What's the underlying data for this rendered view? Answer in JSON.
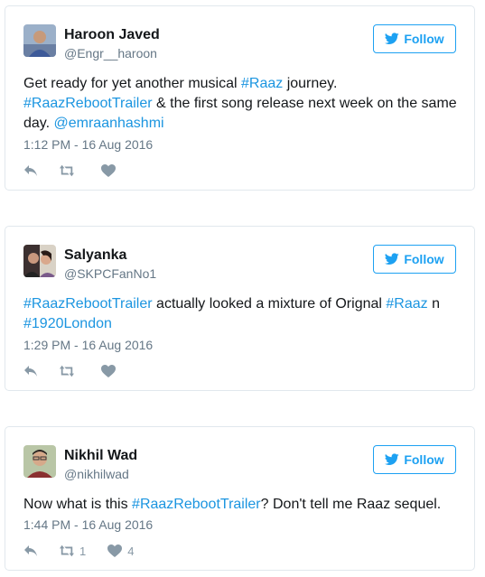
{
  "colors": {
    "accent": "#1da1f2",
    "link": "#1b95e0",
    "muted": "#657786",
    "border": "#e1e8ed"
  },
  "follow_icon": "twitter-bird-icon",
  "tweets": [
    {
      "name": "Haroon Javed",
      "handle": "@Engr__haroon",
      "follow_label": "Follow",
      "text_parts": [
        {
          "t": "Get ready for yet another musical ",
          "tag": false
        },
        {
          "t": "#Raaz",
          "tag": true
        },
        {
          "t": " journey.\n",
          "tag": false
        },
        {
          "t": "#RaazRebootTrailer",
          "tag": true
        },
        {
          "t": " & the first song release next week on the same day. ",
          "tag": false
        },
        {
          "t": "@emraanhashmi",
          "tag": true
        }
      ],
      "timestamp": "1:12 PM - 16 Aug 2016",
      "retweet_count": "",
      "like_count": ""
    },
    {
      "name": "Salyanka",
      "handle": "@SKPCFanNo1",
      "follow_label": "Follow",
      "text_parts": [
        {
          "t": "#RaazRebootTrailer",
          "tag": true
        },
        {
          "t": " actually looked a mixture of Orignal ",
          "tag": false
        },
        {
          "t": "#Raaz",
          "tag": true
        },
        {
          "t": " n\n",
          "tag": false
        },
        {
          "t": "#1920London",
          "tag": true
        }
      ],
      "timestamp": "1:29 PM - 16 Aug 2016",
      "retweet_count": "",
      "like_count": ""
    },
    {
      "name": "Nikhil Wad",
      "handle": "@nikhilwad",
      "follow_label": "Follow",
      "text_parts": [
        {
          "t": "Now what is this ",
          "tag": false
        },
        {
          "t": "#RaazRebootTrailer",
          "tag": true
        },
        {
          "t": "? Don't tell me Raaz sequel.",
          "tag": false
        }
      ],
      "timestamp": "1:44 PM - 16 Aug 2016",
      "retweet_count": "1",
      "like_count": "4"
    }
  ]
}
